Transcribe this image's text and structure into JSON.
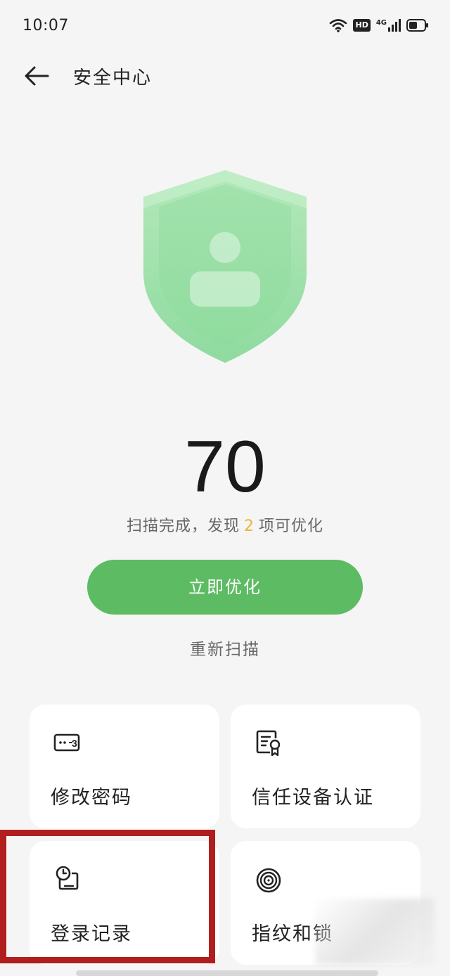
{
  "status_bar": {
    "time": "10:07",
    "hd_label": "HD",
    "network_label": "4G",
    "icons": [
      "wifi-icon",
      "hd-icon",
      "signal-4g-icon",
      "battery-icon"
    ]
  },
  "app_bar": {
    "back_icon": "arrow-left-icon",
    "title": "安全中心"
  },
  "security": {
    "score": "70",
    "summary_prefix": "扫描完成，发现",
    "issue_count": "2",
    "summary_suffix": "项可优化",
    "optimize_label": "立即优化",
    "rescan_label": "重新扫描",
    "shield_icon": "shield-user-icon"
  },
  "cards": [
    {
      "label": "修改密码",
      "icon": "password-icon"
    },
    {
      "label": "信任设备认证",
      "icon": "certificate-icon"
    },
    {
      "label": "登录记录",
      "icon": "login-history-icon"
    },
    {
      "label": "指纹和锁",
      "icon": "fingerprint-icon"
    }
  ],
  "colors": {
    "accent": "#5dbb63",
    "issue_count": "#e8b830",
    "highlight": "#b11e1e",
    "background": "#f5f5f5"
  }
}
